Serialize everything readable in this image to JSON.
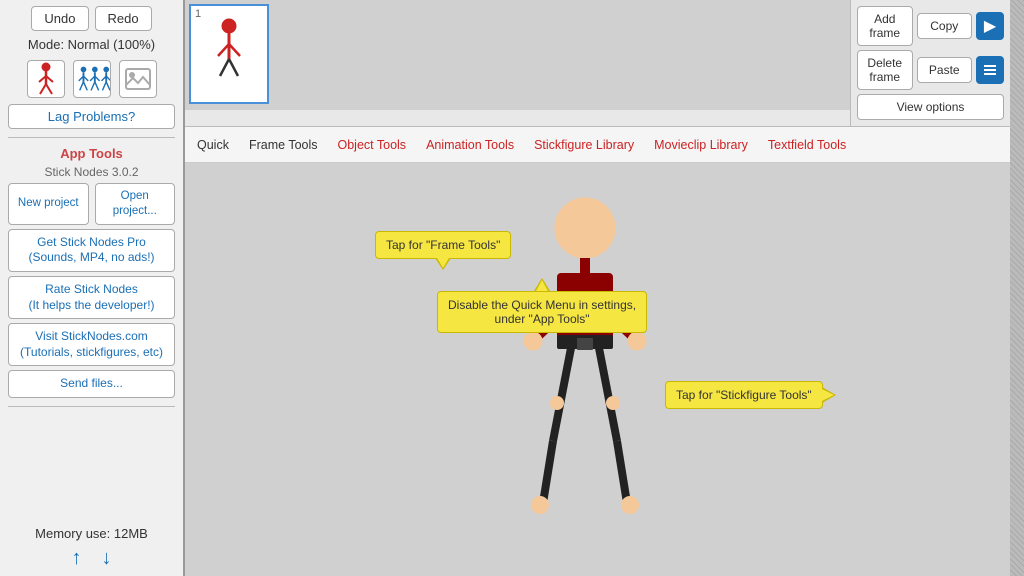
{
  "sidebar": {
    "undo_label": "Undo",
    "redo_label": "Redo",
    "mode_label": "Mode: Normal (100%)",
    "lag_problems_label": "Lag Problems?",
    "app_tools_title": "App Tools",
    "app_version": "Stick Nodes 3.0.2",
    "new_project_label": "New project",
    "open_project_label": "Open project...",
    "pro_label": "Get Stick Nodes Pro\n(Sounds, MP4, no ads!)",
    "rate_label": "Rate Stick Nodes\n(It helps the developer!)",
    "visit_label": "Visit StickNodes.com\n(Tutorials, stickfigures, etc)",
    "send_files_label": "Send files...",
    "memory_label": "Memory use: 12MB"
  },
  "right_panel": {
    "add_frame_label": "Add frame",
    "copy_label": "Copy",
    "delete_frame_label": "Delete frame",
    "paste_label": "Paste",
    "view_options_label": "View options"
  },
  "toolbar": {
    "tabs": [
      {
        "label": "Quick",
        "color": "normal"
      },
      {
        "label": "Frame Tools",
        "color": "normal"
      },
      {
        "label": "Object Tools",
        "color": "red"
      },
      {
        "label": "Animation Tools",
        "color": "red"
      },
      {
        "label": "Stickfigure Library",
        "color": "red"
      },
      {
        "label": "Movieclip Library",
        "color": "red"
      },
      {
        "label": "Textfield Tools",
        "color": "red"
      }
    ]
  },
  "tooltips": {
    "frame_tooltip": "Tap for \"Frame Tools\"",
    "quick_menu_tooltip": "Disable the Quick Menu in settings,\nunder \"App Tools\"",
    "stickfigure_tooltip": "Tap for \"Stickfigure Tools\""
  },
  "frame": {
    "number": "1"
  }
}
